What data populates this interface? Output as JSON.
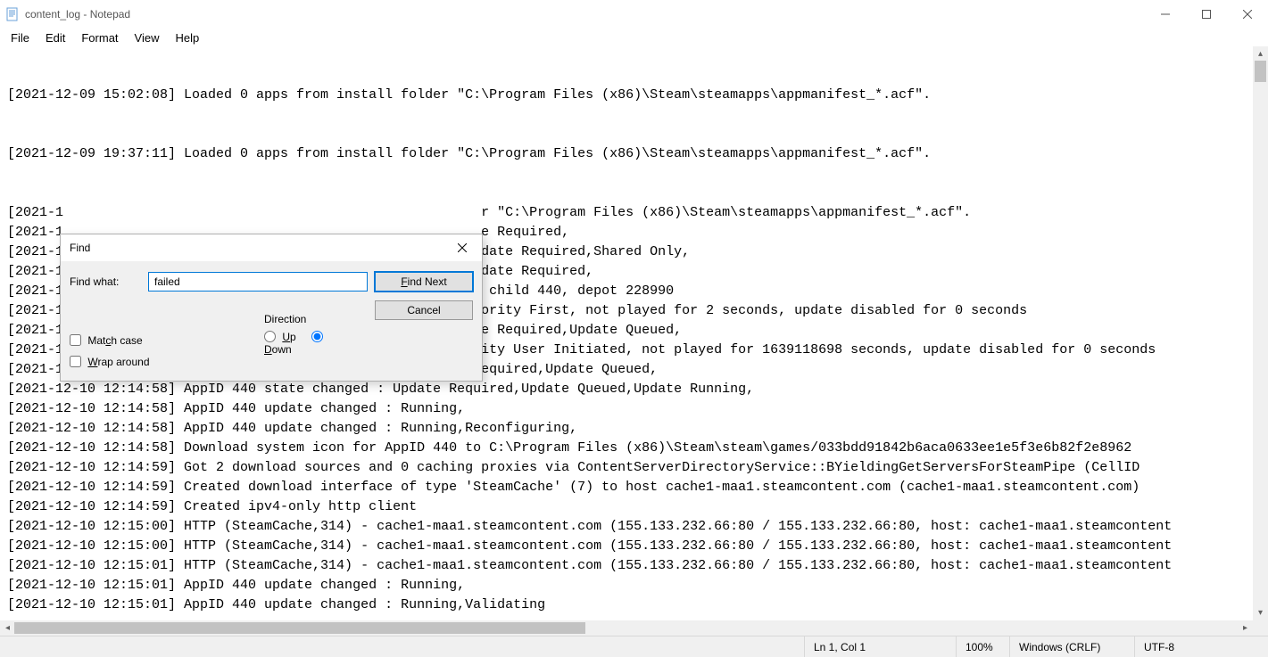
{
  "window": {
    "title": "content_log - Notepad"
  },
  "menu": {
    "file": "File",
    "edit": "Edit",
    "format": "Format",
    "view": "View",
    "help": "Help"
  },
  "document": {
    "lines": [
      "",
      "",
      "[2021-12-09 15:02:08] Loaded 0 apps from install folder \"C:\\Program Files (x86)\\Steam\\steamapps\\appmanifest_*.acf\".",
      "",
      "",
      "[2021-12-09 19:37:11] Loaded 0 apps from install folder \"C:\\Program Files (x86)\\Steam\\steamapps\\appmanifest_*.acf\".",
      "",
      "",
      "[2021-1                                                    r \"C:\\Program Files (x86)\\Steam\\steamapps\\appmanifest_*.acf\".",
      "[2021-1                                                    e Required,",
      "[2021-1                                                    date Required,Shared Only,",
      "[2021-1                                                    date Required,",
      "[2021-1                                                     child 440, depot 228990",
      "[2021-1                                                    ority First, not played for 2 seconds, update disabled for 0 seconds",
      "[2021-1                                                    e Required,Update Queued,",
      "[2021-12-10 12:14:58] AppID 228980 scheduler update : Priority User Initiated, not played for 1639118698 seconds, update disabled for 0 seconds",
      "[2021-12-10 12:14:58] AppID 228980 state changed : Update Required,Update Queued,",
      "[2021-12-10 12:14:58] AppID 440 state changed : Update Required,Update Queued,Update Running,",
      "[2021-12-10 12:14:58] AppID 440 update changed : Running,",
      "[2021-12-10 12:14:58] AppID 440 update changed : Running,Reconfiguring,",
      "[2021-12-10 12:14:58] Download system icon for AppID 440 to C:\\Program Files (x86)\\Steam\\steam\\games/033bdd91842b6aca0633ee1e5f3e6b82f2e8962",
      "[2021-12-10 12:14:59] Got 2 download sources and 0 caching proxies via ContentServerDirectoryService::BYieldingGetServersForSteamPipe (CellID ",
      "[2021-12-10 12:14:59] Created download interface of type 'SteamCache' (7) to host cache1-maa1.steamcontent.com (cache1-maa1.steamcontent.com)",
      "[2021-12-10 12:14:59] Created ipv4-only http client",
      "[2021-12-10 12:15:00] HTTP (SteamCache,314) - cache1-maa1.steamcontent.com (155.133.232.66:80 / 155.133.232.66:80, host: cache1-maa1.steamcontent",
      "[2021-12-10 12:15:00] HTTP (SteamCache,314) - cache1-maa1.steamcontent.com (155.133.232.66:80 / 155.133.232.66:80, host: cache1-maa1.steamcontent",
      "[2021-12-10 12:15:01] HTTP (SteamCache,314) - cache1-maa1.steamcontent.com (155.133.232.66:80 / 155.133.232.66:80, host: cache1-maa1.steamcontent",
      "[2021-12-10 12:15:01] AppID 440 update changed : Running,",
      "[2021-12-10 12:15:01] AppID 440 update changed : Running,Validating"
    ]
  },
  "find": {
    "title": "Find",
    "findwhat_label": "Find what:",
    "findwhat_value": "failed",
    "findnext_label": "Find Next",
    "findnext_accel": "F",
    "cancel_label": "Cancel",
    "direction_label": "Direction",
    "up_label": "Up",
    "up_accel": "U",
    "down_label": "Down",
    "down_accel": "D",
    "matchcase_label": "Match case",
    "matchcase_accel": "c",
    "wrap_label": "Wrap around",
    "wrap_accel": "W"
  },
  "status": {
    "position": "Ln 1, Col 1",
    "zoom": "100%",
    "line_ending": "Windows (CRLF)",
    "encoding": "UTF-8"
  }
}
